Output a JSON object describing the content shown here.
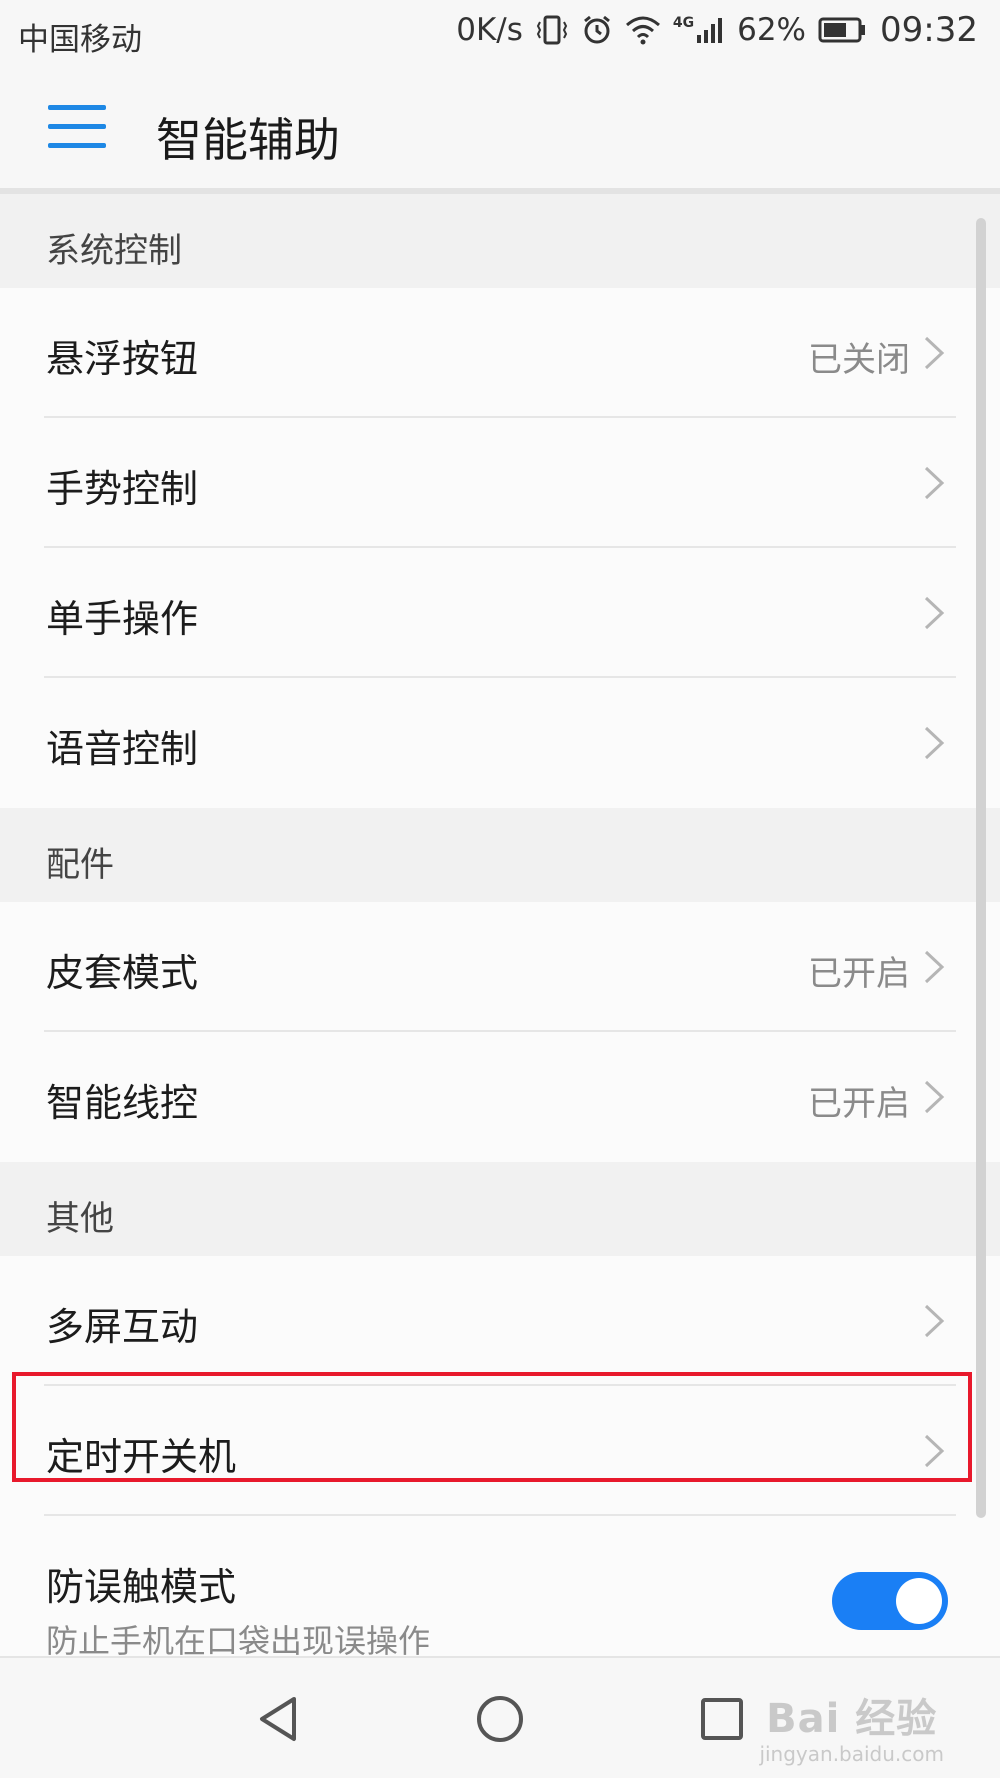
{
  "status_bar": {
    "carrier": "中国移动",
    "net_speed": "0K/s",
    "network_type": "4G",
    "battery": "62%",
    "time": "09:32",
    "icons": [
      "vibrate-icon",
      "alarm-icon",
      "wifi-icon",
      "signal-icon",
      "battery-icon"
    ]
  },
  "app_bar": {
    "title": "智能辅助",
    "menu_icon": "hamburger-menu-icon"
  },
  "sections": {
    "system": {
      "header": "系统控制",
      "items": [
        {
          "label": "悬浮按钮",
          "value": "已关闭"
        },
        {
          "label": "手势控制",
          "value": ""
        },
        {
          "label": "单手操作",
          "value": ""
        },
        {
          "label": "语音控制",
          "value": ""
        }
      ]
    },
    "accessory": {
      "header": "配件",
      "items": [
        {
          "label": "皮套模式",
          "value": "已开启"
        },
        {
          "label": "智能线控",
          "value": "已开启"
        }
      ]
    },
    "other": {
      "header": "其他",
      "items": [
        {
          "label": "多屏互动",
          "value": ""
        },
        {
          "label": "定时开关机",
          "value": ""
        },
        {
          "label": "防误触模式",
          "sub": "防止手机在口袋出现误操作",
          "toggle_on": true
        }
      ]
    }
  },
  "nav_bar": {
    "back_icon": "back-triangle-icon",
    "home_icon": "home-circle-icon",
    "recents_icon": "recents-square-icon"
  },
  "watermark": {
    "brand": "Bai 经验",
    "url": "jingyan.baidu.com"
  },
  "colors": {
    "accent": "#1a7ff5",
    "highlight_border": "#e8192c",
    "menu_icon": "#1e88e5"
  }
}
